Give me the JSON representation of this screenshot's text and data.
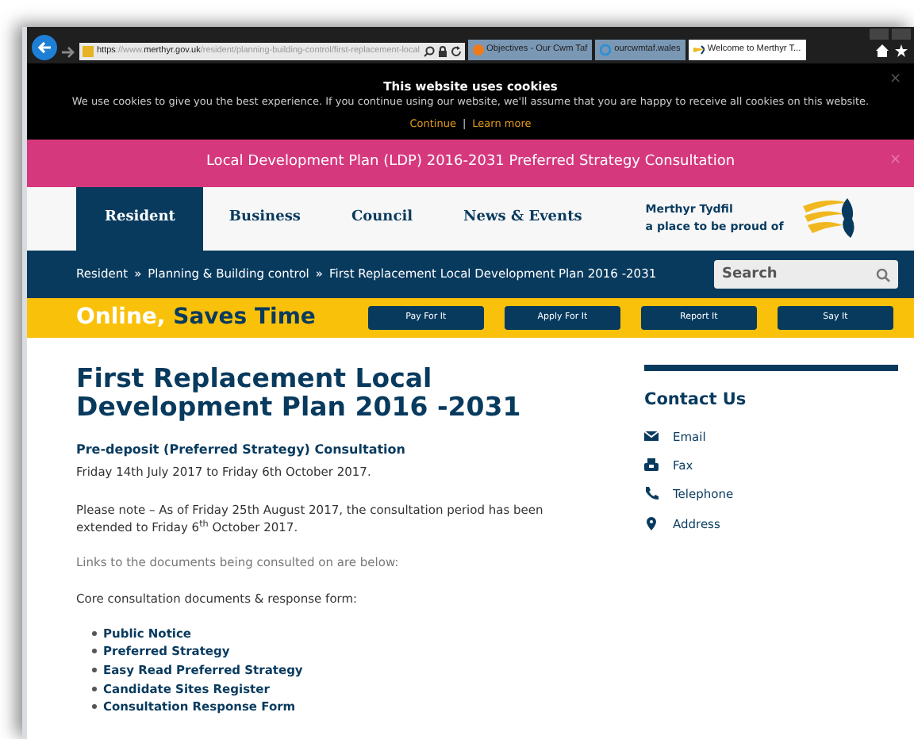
{
  "browser": {
    "url_scheme": "https",
    "url_host": "://www.merthyr.gov.uk",
    "url_path": "/resident/planning-building-control/first-replacement-local",
    "tabs": [
      {
        "title": "Objectives - Our Cwm Taf",
        "selected": false,
        "kind": "orange"
      },
      {
        "title": "ourcwmtaf.wales",
        "selected": false,
        "kind": "ie"
      },
      {
        "title": "Welcome to Merthyr T...",
        "selected": true,
        "kind": "site"
      }
    ]
  },
  "cookie_banner": {
    "title": "This website uses cookies",
    "message": "We use cookies to give you the best experience. If you continue using our website, we'll assume that you are happy to receive all cookies on this website.",
    "links": [
      "Continue",
      "Learn more"
    ],
    "separator": "|",
    "close": "×"
  },
  "alert": {
    "text": "Local Development Plan (LDP) 2016-2031 Preferred Strategy Consultation",
    "close": "×"
  },
  "nav": {
    "items": [
      {
        "label": "Resident",
        "selected": true
      },
      {
        "label": "Business",
        "selected": false
      },
      {
        "label": "Council",
        "selected": false
      },
      {
        "label": "News & Events",
        "selected": false
      }
    ],
    "tagline": [
      "Merthyr Tydfil",
      "a place to be proud of"
    ]
  },
  "breadcrumb": {
    "items": [
      "Resident",
      "Planning & Building control",
      "First Replacement Local Development Plan 2016 -2031"
    ],
    "separator": "»"
  },
  "search": {
    "placeholder": "Search"
  },
  "promo": {
    "title_lead": "Online,",
    "title_rest": "Saves Time",
    "buttons": [
      "Pay For It",
      "Apply For It",
      "Report It",
      "Say It"
    ]
  },
  "main": {
    "heading": "First Replacement Local Development Plan 2016 -2031",
    "subheading": "Pre-deposit (Preferred Strategy) Consultation",
    "paragraphs": [
      {
        "text": "Friday 14th July 2017 to Friday 6th October 2017.",
        "kind": "date"
      },
      {
        "text": "Please note – As of Friday 25th August 2017, the consultation period has been extended to Friday 6$^{th}$ October 2017.",
        "kind": "body"
      },
      {
        "text": "Links to the documents being consulted on are below:",
        "kind": "muted"
      },
      {
        "text": "Core consultation documents & response form:",
        "kind": "body"
      }
    ],
    "links": [
      "Public Notice",
      "Preferred Strategy",
      "Easy Read Preferred Strategy",
      "Candidate Sites Register",
      "Consultation Response Form"
    ]
  },
  "sidebar": {
    "title": "Contact Us",
    "items": [
      {
        "label": "Email",
        "kind": "email"
      },
      {
        "label": "Fax",
        "kind": "fax"
      },
      {
        "label": "Telephone",
        "kind": "phone"
      },
      {
        "label": "Address",
        "kind": "address"
      }
    ]
  }
}
